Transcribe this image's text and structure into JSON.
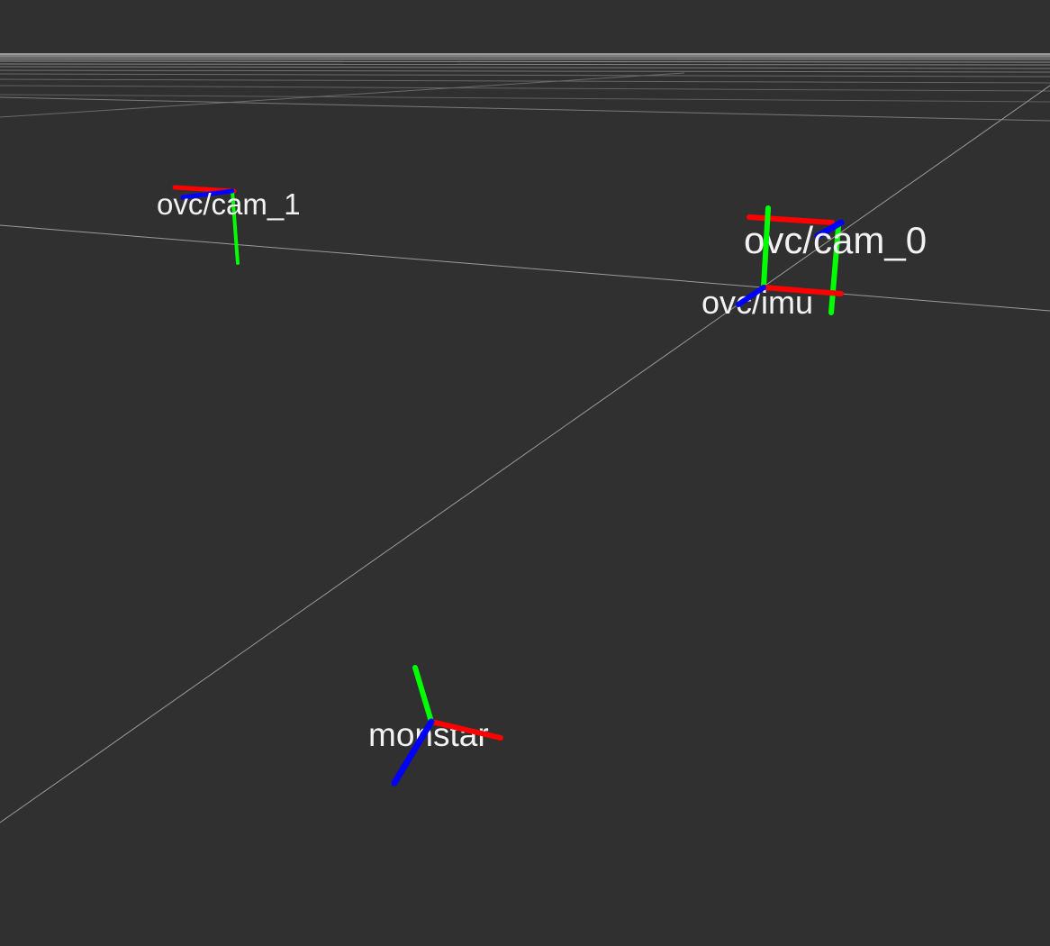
{
  "viewport": {
    "background_color": "#303030",
    "grid_color": "#a0a0a0",
    "horizon_color": "#b4b4b4"
  },
  "axis_colors": {
    "x": "#ff0000",
    "y": "#00ff00",
    "z": "#0000ff"
  },
  "frames": [
    {
      "id": "cam1",
      "label": "ovc/cam_1"
    },
    {
      "id": "cam0",
      "label": "ovc/cam_0"
    },
    {
      "id": "imu",
      "label": "ovc/imu"
    },
    {
      "id": "monstar",
      "label": "monstar"
    }
  ]
}
